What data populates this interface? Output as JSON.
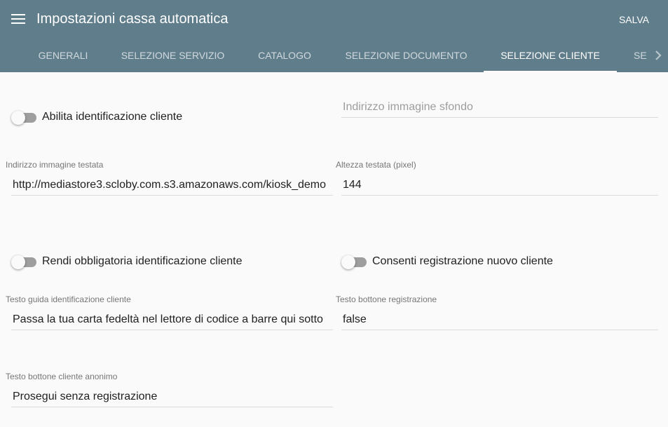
{
  "header": {
    "title": "Impostazioni cassa automatica",
    "save_label": "SALVA",
    "menu_icon": "menu-icon",
    "background": "#607d8b"
  },
  "tabs": [
    {
      "label": "GENERALI",
      "active": false
    },
    {
      "label": "SELEZIONE SERVIZIO",
      "active": false
    },
    {
      "label": "CATALOGO",
      "active": false
    },
    {
      "label": "SELEZIONE DOCUMENTO",
      "active": false
    },
    {
      "label": "SELEZIONE CLIENTE",
      "active": true
    },
    {
      "label": "SELEZIONE",
      "active": false
    }
  ],
  "form": {
    "enable_identification": {
      "label": "Abilita identificazione cliente",
      "checked": false
    },
    "background_image": {
      "placeholder": "Indirizzo immagine sfondo",
      "value": ""
    },
    "header_image": {
      "label": "Indirizzo immagine testata",
      "value": "http://mediastore3.scloby.com.s3.amazonaws.com/kiosk_demo"
    },
    "header_height": {
      "label": "Altezza testata (pixel)",
      "value": "144"
    },
    "mandatory_identification": {
      "label": "Rendi obbligatoria identificazione cliente",
      "checked": false
    },
    "allow_registration": {
      "label": "Consenti registrazione nuovo cliente",
      "checked": false
    },
    "guide_text": {
      "label": "Testo guida identificazione cliente",
      "value": "Passa la tua carta fedeltà nel lettore di codice a barre qui sotto"
    },
    "registration_button_text": {
      "label": "Testo bottone registrazione",
      "value": "false"
    },
    "anonymous_button_text": {
      "label": "Testo bottone cliente anonimo",
      "value": "Prosegui senza registrazione"
    }
  }
}
